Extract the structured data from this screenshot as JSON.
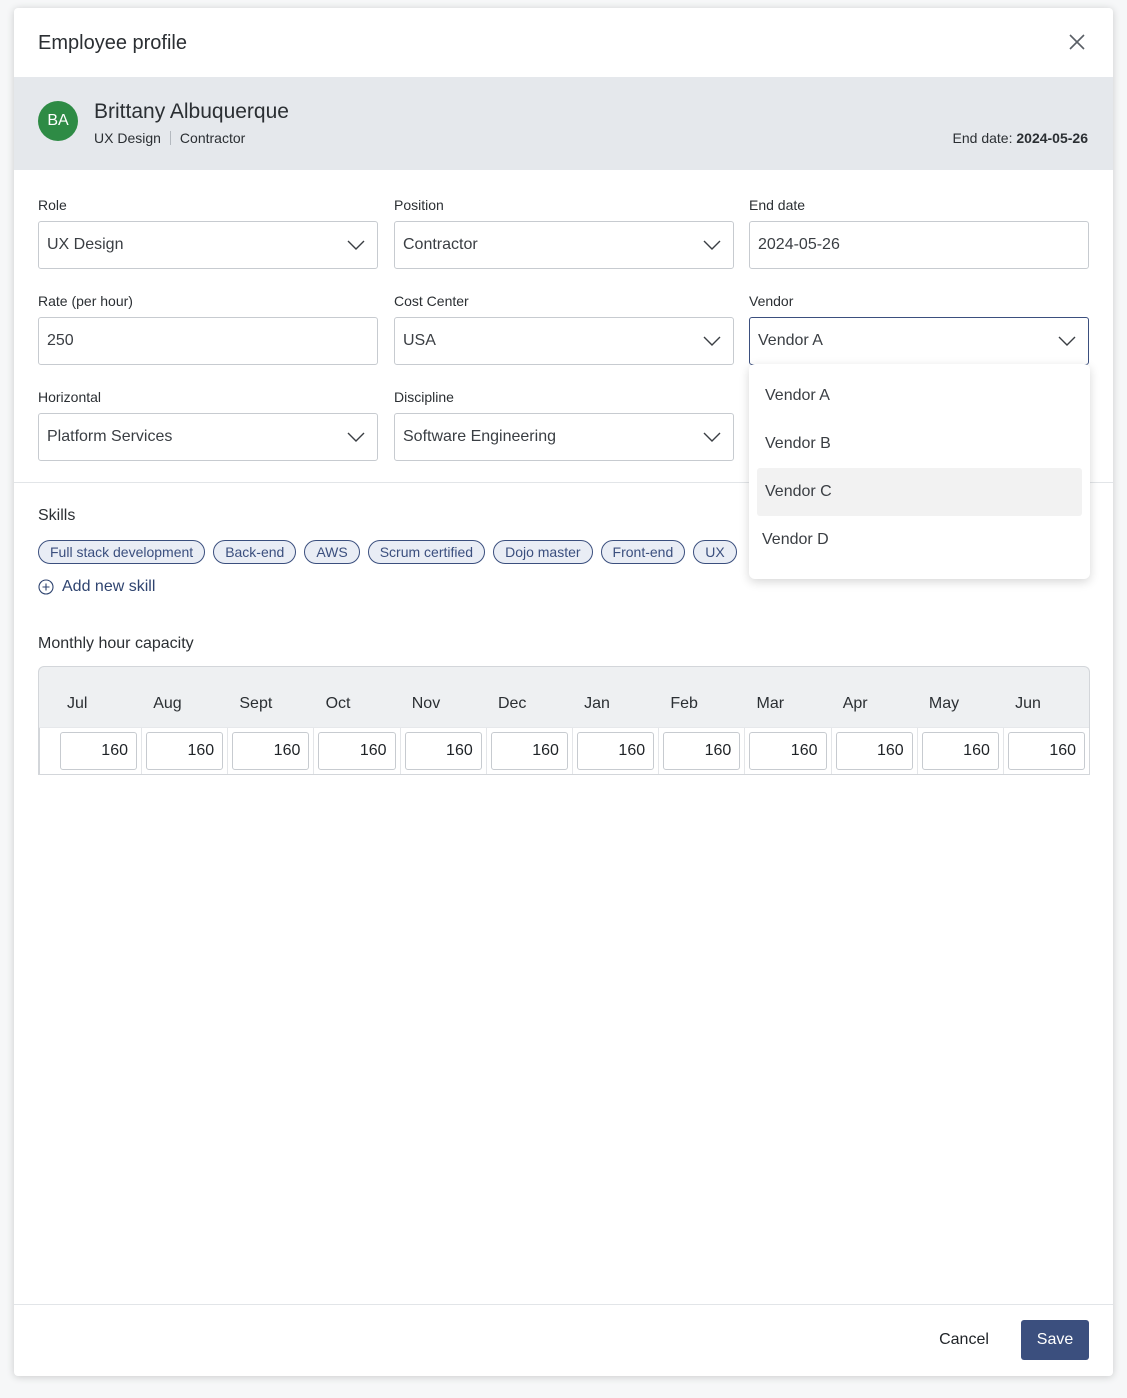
{
  "dialog": {
    "title": "Employee profile"
  },
  "employee": {
    "initials": "BA",
    "avatar_color": "#2e8b45",
    "name": "Brittany Albuquerque",
    "role": "UX Design",
    "position": "Contractor",
    "end_date_label": "End date:",
    "end_date": "2024-05-26"
  },
  "form": {
    "role": {
      "label": "Role",
      "value": "UX Design"
    },
    "position": {
      "label": "Position",
      "value": "Contractor"
    },
    "end_date": {
      "label": "End date",
      "value": "2024-05-26"
    },
    "rate": {
      "label": "Rate (per hour)",
      "value": "250"
    },
    "cost_center": {
      "label": "Cost Center",
      "value": "USA"
    },
    "vendor": {
      "label": "Vendor",
      "value": "Vendor A"
    },
    "horizontal": {
      "label": "Horizontal",
      "value": "Platform Services"
    },
    "discipline": {
      "label": "Discipline",
      "value": "Software Engineering"
    }
  },
  "vendor_dropdown": {
    "options": [
      "Vendor A",
      "Vendor B",
      "Vendor C",
      "Vendor D"
    ],
    "hovered": "Vendor C"
  },
  "skills": {
    "title": "Skills",
    "items": [
      "Full stack development",
      "Back-end",
      "AWS",
      "Scrum certified",
      "Dojo master",
      "Front-end",
      "UX"
    ],
    "add_label": "Add new skill"
  },
  "capacity": {
    "title": "Monthly hour capacity",
    "months": [
      "Jul",
      "Aug",
      "Sept",
      "Oct",
      "Nov",
      "Dec",
      "Jan",
      "Feb",
      "Mar",
      "Apr",
      "May",
      "Jun"
    ],
    "values": [
      "160",
      "160",
      "160",
      "160",
      "160",
      "160",
      "160",
      "160",
      "160",
      "160",
      "160",
      "160"
    ]
  },
  "footer": {
    "cancel_label": "Cancel",
    "save_label": "Save",
    "save_color": "#3b4f7e"
  }
}
